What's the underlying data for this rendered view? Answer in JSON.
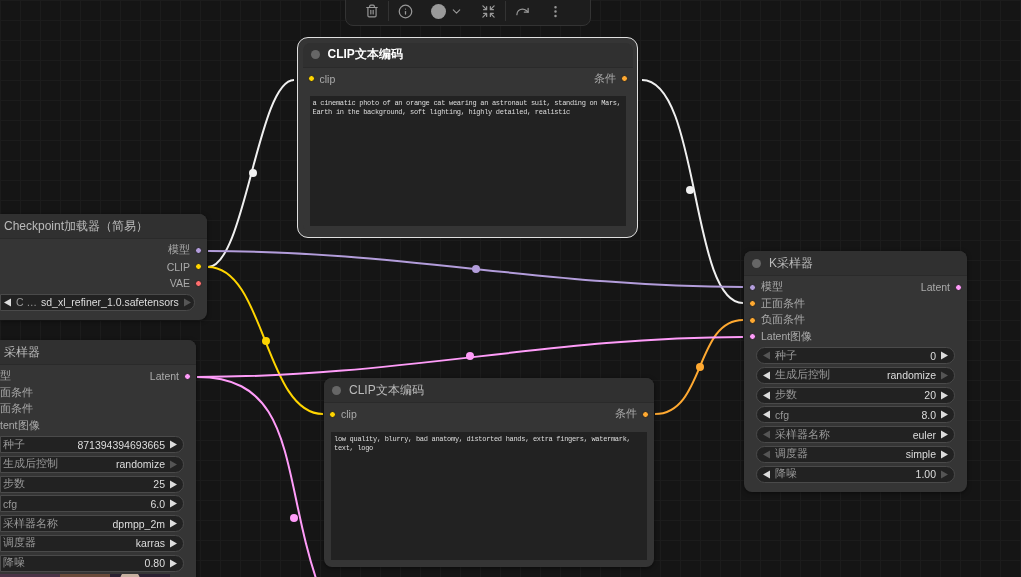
{
  "nodes": [
    {
      "title": "Checkpoint加载器（简易）",
      "selected": false,
      "outputs": [
        {
          "label": "模型",
          "color": "#b39ddb"
        },
        {
          "label": "CLIP",
          "color": "#ffd500"
        },
        {
          "label": "VAE",
          "color": "#ff6e6e"
        }
      ],
      "widgets": [
        {
          "label": "C …",
          "value": "sd_xl_refiner_1.0.safetensors",
          "left_disabled": false,
          "right_disabled": true
        }
      ]
    },
    {
      "title": "CLIP文本编码",
      "selected": true,
      "inputs": [
        {
          "label": "clip",
          "color": "#ffd500"
        }
      ],
      "outputs": [
        {
          "label": "条件",
          "color": "#ffa931"
        }
      ],
      "prompt": "a cinematic photo of an orange cat wearing an astronaut suit, standing on Mars, Earth in the background, soft lighting, highly detailed, realistic"
    },
    {
      "title": "采样器",
      "selected": false,
      "inputs": [
        {
          "label": "型"
        },
        {
          "label": "面条件"
        },
        {
          "label": "面条件"
        },
        {
          "label": "tent图像"
        }
      ],
      "outputs": [
        {
          "label": "Latent",
          "color": "#ff9cf9"
        }
      ],
      "widgets": [
        {
          "label": "种子",
          "value": "871394394693665",
          "right_disabled": false
        },
        {
          "label": "生成后控制",
          "value": "randomize",
          "right_disabled": true
        },
        {
          "label": "步数",
          "value": "25",
          "right_disabled": false
        },
        {
          "label": "cfg",
          "value": "6.0",
          "right_disabled": false
        },
        {
          "label": "采样器名称",
          "value": "dpmpp_2m",
          "right_disabled": false
        },
        {
          "label": "调度器",
          "value": "karras",
          "right_disabled": false
        },
        {
          "label": "降噪",
          "value": "0.80",
          "right_disabled": false
        }
      ],
      "preview": {
        "kind": "picture"
      }
    },
    {
      "title": "CLIP文本编码",
      "selected": false,
      "inputs": [
        {
          "label": "clip",
          "color": "#ffd500"
        }
      ],
      "outputs": [
        {
          "label": "条件",
          "color": "#ffa931"
        }
      ],
      "prompt": "low quality, blurry, bad anatomy, distorted hands, extra fingers, watermark, text, logo"
    },
    {
      "title": "K采样器",
      "selected": false,
      "inputs": [
        {
          "label": "模型",
          "color": "#b39ddb"
        },
        {
          "label": "正面条件",
          "color": "#ffa931"
        },
        {
          "label": "负面条件",
          "color": "#ffa931"
        },
        {
          "label": "Latent图像",
          "color": "#ff9cf9"
        }
      ],
      "outputs": [
        {
          "label": "Latent",
          "color": "#ff9cf9"
        }
      ],
      "widgets": [
        {
          "label": "种子",
          "value": "0",
          "left_disabled": true,
          "right_disabled": false
        },
        {
          "label": "生成后控制",
          "value": "randomize",
          "left_disabled": false,
          "right_disabled": true
        },
        {
          "label": "步数",
          "value": "20",
          "left_disabled": false,
          "right_disabled": false
        },
        {
          "label": "cfg",
          "value": "8.0",
          "left_disabled": false,
          "right_disabled": false
        },
        {
          "label": "采样器名称",
          "value": "euler",
          "left_disabled": true,
          "right_disabled": false
        },
        {
          "label": "调度器",
          "value": "simple",
          "left_disabled": true,
          "right_disabled": false
        },
        {
          "label": "降噪",
          "value": "1.00",
          "left_disabled": false,
          "right_disabled": true
        }
      ]
    }
  ]
}
